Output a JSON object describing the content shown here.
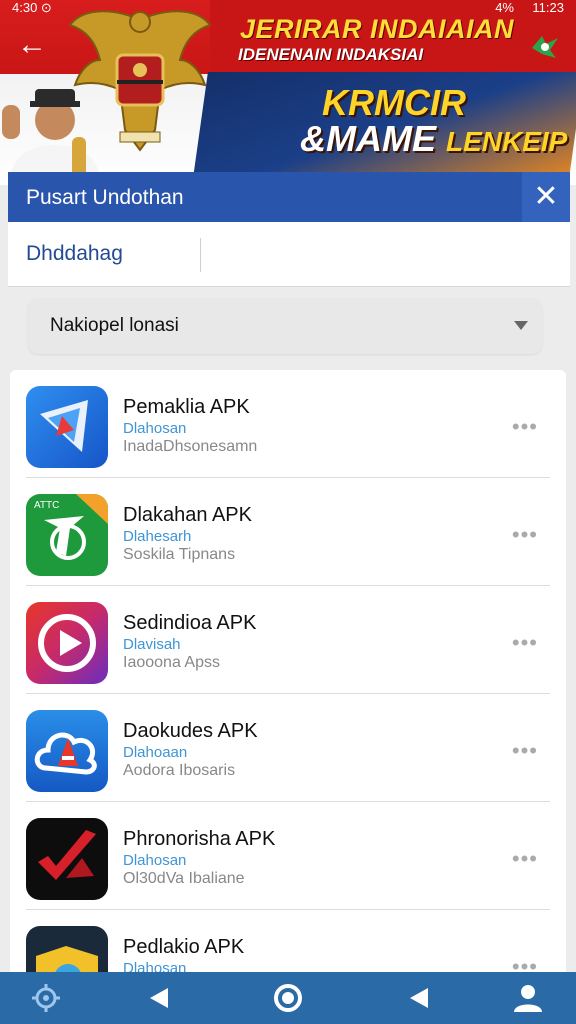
{
  "status_bar": {
    "left_text": "4:30 ⊙",
    "signal_text": "4%",
    "time": "11:23"
  },
  "banner": {
    "title_line1": "JERIRAR INDAIAIAN",
    "title_line2": "IDENENAIN INDAKSIAI",
    "promo_line1": "KRMCIR",
    "promo_line2_a": "&MAME",
    "promo_line2_b": "LENKEIP",
    "colors": {
      "red": "#c81515",
      "yellow": "#ffd428",
      "navy": "#1b3f88"
    }
  },
  "dialog": {
    "title": "Pusart Undothan",
    "search_value": "Dhddahag",
    "filter_label": "Nakiopel lonasi",
    "header_color": "#2a55ad"
  },
  "apps": [
    {
      "name": "Pemaklia APK",
      "status": "Dlahosan",
      "category": "InadaDhsonesamn",
      "more": "•••",
      "icon": "kite-icon"
    },
    {
      "name": "Dlakahan APK",
      "status": "Dlahesarh",
      "category": "Soskila Tipnans",
      "more": "•••",
      "icon": "green-badge-icon"
    },
    {
      "name": "Sedindioa APK",
      "status": "Dlavisah",
      "category": "Iaooona Apss",
      "more": "•••",
      "icon": "play-circle-icon"
    },
    {
      "name": "Daokudes APK",
      "status": "Dlahoaan",
      "category": "Aodora Ibosaris",
      "more": "•••",
      "icon": "cloud-a-icon"
    },
    {
      "name": "Phronorisha APK",
      "status": "Dlahosan",
      "category": "Ol30dVa Ibaliane",
      "more": "•••",
      "icon": "red-check-icon"
    },
    {
      "name": "Pedlakio APK",
      "status": "Dlahosan",
      "category": "",
      "more": "•••",
      "icon": "map-icon"
    }
  ],
  "navbar": {
    "color": "#2a6aa6",
    "buttons": [
      "settings-icon",
      "back-triangle-icon",
      "home-circle-icon",
      "recents-triangle-icon",
      "profile-icon"
    ]
  }
}
